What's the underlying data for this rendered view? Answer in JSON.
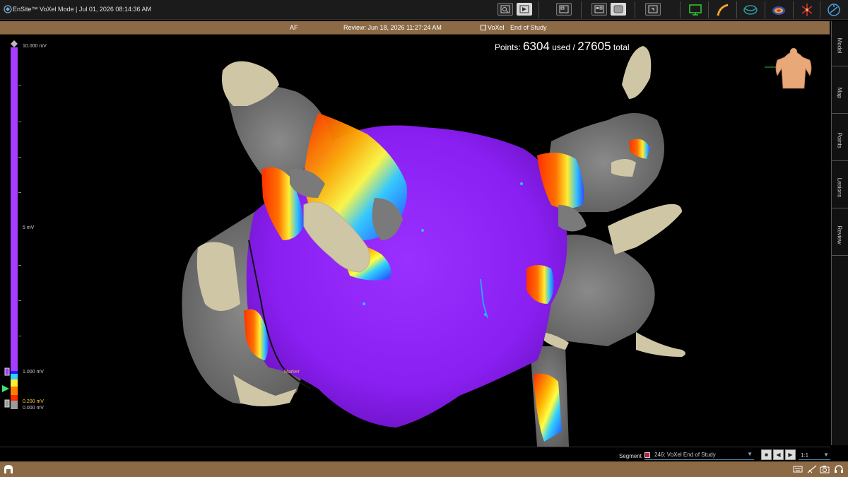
{
  "app": {
    "title": "EnSite™ VoXel Mode |  Jul 01, 2026 08:14:36 AM"
  },
  "toolbar": {
    "icons": [
      "zoom-icon",
      "view-icon",
      "layout-icon",
      "compare-icon",
      "window-icon",
      "monitor-icon",
      "catheter-icon",
      "mapping-icon",
      "surface-icon",
      "ablation-icon",
      "settings-icon"
    ]
  },
  "status": {
    "mode": "AF",
    "review": "Review: Jun 18, 2026 11:27:24 AM",
    "voxel": "VoXel",
    "end": "End of Study"
  },
  "points": {
    "label": "Points:",
    "used": "6304",
    "used_label": "used /",
    "total": "27605",
    "total_label": "total"
  },
  "scale": {
    "max": "10.000 mV",
    "mid": "5 mV",
    "high_threshold": "1.000 mV",
    "low_threshold": "0.200 mV",
    "min": "0.000 mV",
    "colors": {
      "top": "#a63cff",
      "bottom_red": "#ff2a00",
      "gray": "#9a9a9a"
    }
  },
  "marker": "Marker",
  "sidetabs": [
    "Model",
    "Map",
    "Points",
    "Lesions",
    "Review"
  ],
  "segment": {
    "label": "Segment",
    "value": "246: VoXel End of Study",
    "speed": "1:1"
  },
  "colors": {
    "chamber": "#9426ff",
    "vein": "#cfc6a6",
    "gray": "#7d7d7d",
    "status": "#8b6a45"
  }
}
